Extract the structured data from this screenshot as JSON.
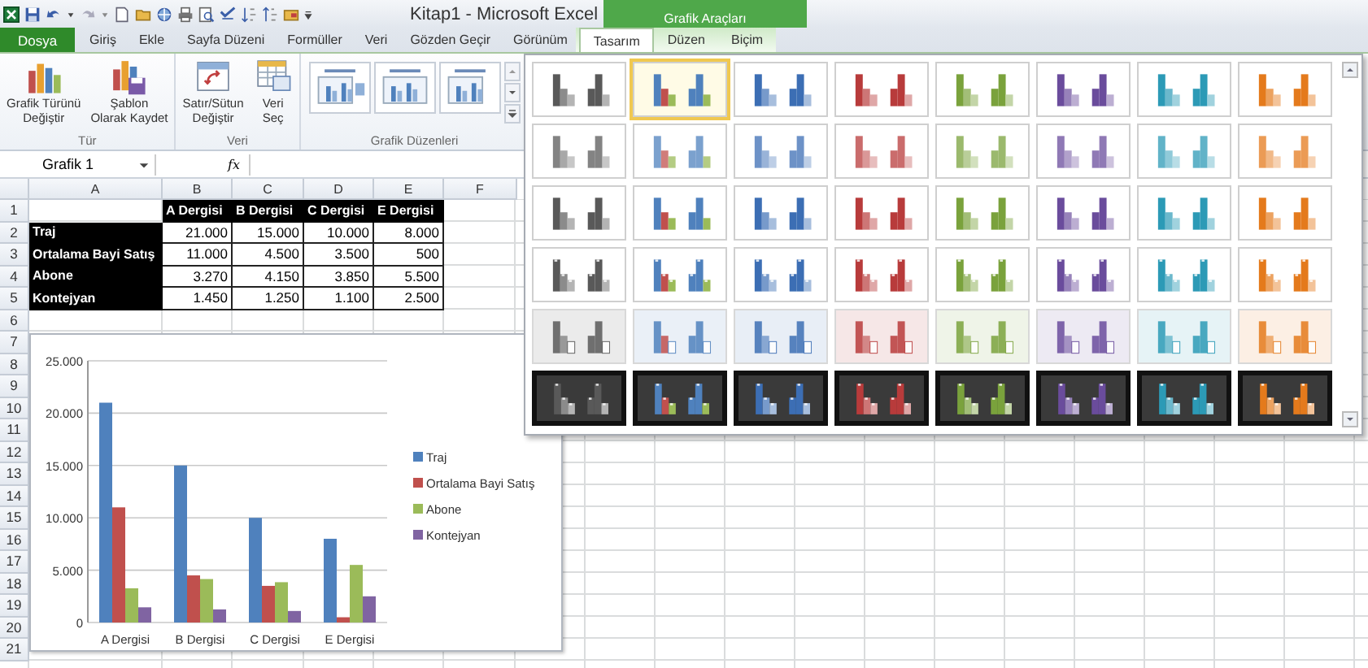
{
  "window": {
    "title": "Kitap1 - Microsoft Excel"
  },
  "tabs": [
    {
      "label": "Dosya",
      "kind": "file",
      "selected": false
    },
    {
      "label": "Giriş",
      "kind": "tab",
      "selected": false
    },
    {
      "label": "Ekle",
      "kind": "tab",
      "selected": false
    },
    {
      "label": "Sayfa Düzeni",
      "kind": "tab",
      "selected": false
    },
    {
      "label": "Formüller",
      "kind": "tab",
      "selected": false
    },
    {
      "label": "Veri",
      "kind": "tab",
      "selected": false
    },
    {
      "label": "Gözden Geçir",
      "kind": "tab",
      "selected": false
    },
    {
      "label": "Görünüm",
      "kind": "tab",
      "selected": false
    }
  ],
  "context_tabs": {
    "label": "Grafik Araçları",
    "tabs": [
      {
        "label": "Tasarım",
        "selected": true
      },
      {
        "label": "Düzen",
        "selected": false
      },
      {
        "label": "Biçim",
        "selected": false
      }
    ]
  },
  "ribbon_groups": [
    {
      "label": "Tür",
      "kind": "buttons",
      "buttons": [
        {
          "lines": [
            "Grafik Türünü",
            "Değiştir"
          ],
          "kind": "chart-type"
        },
        {
          "lines": [
            "Şablon",
            "Olarak Kaydet"
          ],
          "kind": "template"
        }
      ]
    },
    {
      "label": "Veri",
      "kind": "buttons",
      "buttons": [
        {
          "lines": [
            "Satır/Sütun",
            "Değiştir"
          ],
          "kind": "switch"
        },
        {
          "lines": [
            "Veri",
            "Seç"
          ],
          "kind": "select-data"
        }
      ]
    },
    {
      "label": "Grafik Düzenleri",
      "kind": "layouts"
    }
  ],
  "name_box": "Grafik 1",
  "function_label": "fx",
  "columns": [
    "A",
    "B",
    "C",
    "D",
    "E",
    "F"
  ],
  "rows": [
    {
      "number": "1",
      "cells": [
        {
          "kind": "empty"
        },
        {
          "kind": "label",
          "text": "A Dergisi"
        },
        {
          "kind": "label",
          "text": "B Dergisi"
        },
        {
          "kind": "label",
          "text": "C Dergisi"
        },
        {
          "kind": "label",
          "text": "E Dergisi"
        }
      ]
    },
    {
      "number": "2",
      "cells": [
        {
          "kind": "label",
          "text": "Traj"
        },
        {
          "kind": "number",
          "text": "21.000"
        },
        {
          "kind": "number",
          "text": "15.000"
        },
        {
          "kind": "number",
          "text": "10.000"
        },
        {
          "kind": "number",
          "text": "8.000"
        }
      ]
    },
    {
      "number": "3",
      "cells": [
        {
          "kind": "label",
          "text": "Ortalama Bayi Satış"
        },
        {
          "kind": "number",
          "text": "11.000"
        },
        {
          "kind": "number",
          "text": "4.500"
        },
        {
          "kind": "number",
          "text": "3.500"
        },
        {
          "kind": "number",
          "text": "500"
        }
      ]
    },
    {
      "number": "4",
      "cells": [
        {
          "kind": "label",
          "text": "Abone"
        },
        {
          "kind": "number",
          "text": "3.270"
        },
        {
          "kind": "number",
          "text": "4.150"
        },
        {
          "kind": "number",
          "text": "3.850"
        },
        {
          "kind": "number",
          "text": "5.500"
        }
      ]
    },
    {
      "number": "5",
      "cells": [
        {
          "kind": "label",
          "text": "Kontejyan"
        },
        {
          "kind": "number",
          "text": "1.450"
        },
        {
          "kind": "number",
          "text": "1.250"
        },
        {
          "kind": "number",
          "text": "1.100"
        },
        {
          "kind": "number",
          "text": "2.500"
        }
      ]
    },
    {
      "number": "6"
    },
    {
      "number": "7"
    },
    {
      "number": "8"
    },
    {
      "number": "9"
    },
    {
      "number": "10"
    },
    {
      "number": "11"
    },
    {
      "number": "12"
    },
    {
      "number": "13"
    },
    {
      "number": "14"
    },
    {
      "number": "15"
    },
    {
      "number": "16"
    },
    {
      "number": "17"
    },
    {
      "number": "18"
    },
    {
      "number": "19"
    },
    {
      "number": "20"
    },
    {
      "number": "21"
    }
  ],
  "chart": {
    "chart_data": {
      "type": "bar",
      "categories": [
        "A Dergisi",
        "B Dergisi",
        "C Dergisi",
        "E Dergisi"
      ],
      "series": [
        {
          "name": "Traj",
          "color": "#4f81bd",
          "values": [
            21000,
            15000,
            10000,
            8000
          ]
        },
        {
          "name": "Ortalama Bayi Satış",
          "color": "#c0504d",
          "values": [
            11000,
            4500,
            3500,
            500
          ]
        },
        {
          "name": "Abone",
          "color": "#9bbb59",
          "values": [
            3270,
            4150,
            3850,
            5500
          ]
        },
        {
          "name": "Kontejyan",
          "color": "#8064a2",
          "values": [
            1450,
            1250,
            1100,
            2500
          ]
        }
      ],
      "ylim": [
        0,
        25000
      ],
      "grid": true,
      "legend": true,
      "yticks": [
        {
          "value": 0,
          "label": "0"
        },
        {
          "value": 5000,
          "label": "5.000"
        },
        {
          "value": 10000,
          "label": "10.000"
        },
        {
          "value": 15000,
          "label": "15.000"
        },
        {
          "value": 20000,
          "label": "20.000"
        },
        {
          "value": 25000,
          "label": "25.000"
        }
      ]
    }
  },
  "style_gallery": {
    "palettes": [
      {
        "kind": "mono",
        "color": "#595959"
      },
      {
        "kind": "multi",
        "color": "#4f81bd"
      },
      {
        "kind": "mono",
        "color": "#3c6eb4"
      },
      {
        "kind": "mono",
        "color": "#b83b3b"
      },
      {
        "kind": "mono",
        "color": "#7aa23c"
      },
      {
        "kind": "mono",
        "color": "#6a4c9c"
      },
      {
        "kind": "mono",
        "color": "#2c9ab6"
      },
      {
        "kind": "mono",
        "color": "#e47a1c"
      }
    ],
    "rows": [
      {
        "kind": "flat",
        "items": [
          {
            "selected": false
          },
          {
            "selected": true
          },
          {
            "selected": false
          },
          {
            "selected": false
          },
          {
            "selected": false
          },
          {
            "selected": false
          },
          {
            "selected": false
          },
          {
            "selected": false
          }
        ]
      },
      {
        "kind": "soft",
        "items": [
          {
            "selected": false
          },
          {
            "selected": false
          },
          {
            "selected": false
          },
          {
            "selected": false
          },
          {
            "selected": false
          },
          {
            "selected": false
          },
          {
            "selected": false
          },
          {
            "selected": false
          }
        ]
      },
      {
        "kind": "bold",
        "items": [
          {
            "selected": false
          },
          {
            "selected": false
          },
          {
            "selected": false
          },
          {
            "selected": false
          },
          {
            "selected": false
          },
          {
            "selected": false
          },
          {
            "selected": false
          },
          {
            "selected": false
          }
        ]
      },
      {
        "kind": "bevel",
        "items": [
          {
            "selected": false
          },
          {
            "selected": false
          },
          {
            "selected": false
          },
          {
            "selected": false
          },
          {
            "selected": false
          },
          {
            "selected": false
          },
          {
            "selected": false
          },
          {
            "selected": false
          }
        ]
      },
      {
        "kind": "tinted",
        "items": [
          {
            "selected": false
          },
          {
            "selected": false
          },
          {
            "selected": false
          },
          {
            "selected": false
          },
          {
            "selected": false
          },
          {
            "selected": false
          },
          {
            "selected": false
          },
          {
            "selected": false
          }
        ]
      },
      {
        "kind": "dark",
        "items": [
          {
            "selected": false
          },
          {
            "selected": false
          },
          {
            "selected": false
          },
          {
            "selected": false
          },
          {
            "selected": false
          },
          {
            "selected": false
          },
          {
            "selected": false
          },
          {
            "selected": false
          }
        ]
      }
    ]
  }
}
